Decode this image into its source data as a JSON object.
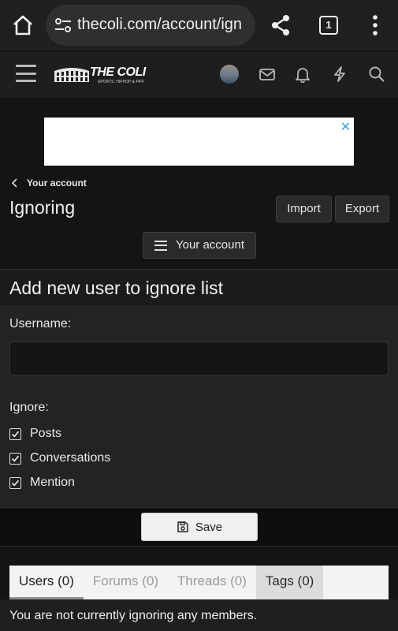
{
  "browser": {
    "url": "thecoli.com/account/ign",
    "tab_count": "1",
    "icons": [
      "home-icon",
      "site-settings-icon",
      "share-icon",
      "tab-switcher-icon",
      "more-vert-icon"
    ]
  },
  "site": {
    "logo_text": "THE COLI",
    "logo_subtext": "SPORTS, HIPHOP & PIFF",
    "header_icons": [
      "menu-icon",
      "avatar",
      "mail-icon",
      "bell-icon",
      "lightning-icon",
      "search-icon"
    ]
  },
  "ad": {
    "close_symbol": "✕"
  },
  "breadcrumb": {
    "label": "Your account"
  },
  "page": {
    "title": "Ignoring",
    "import_label": "Import",
    "export_label": "Export",
    "your_account_label": "Your account"
  },
  "form": {
    "title": "Add new user to ignore list",
    "username_label": "Username:",
    "username_value": "",
    "ignore_label": "Ignore:",
    "options": [
      {
        "label": "Posts",
        "checked": true
      },
      {
        "label": "Conversations",
        "checked": true
      },
      {
        "label": "Mention",
        "checked": true
      }
    ],
    "save_label": "Save"
  },
  "tabs": [
    {
      "label": "Users (0)",
      "state": "active"
    },
    {
      "label": "Forums (0)",
      "state": "inactive"
    },
    {
      "label": "Threads (0)",
      "state": "inactive"
    },
    {
      "label": "Tags (0)",
      "state": "shaded"
    }
  ],
  "notice": "You are not currently ignoring any members.",
  "colors": {
    "background": "#141414",
    "header": "#1e1e1e",
    "accent_ad_close": "#2aa6de",
    "save_button": "#f0f0f0"
  }
}
